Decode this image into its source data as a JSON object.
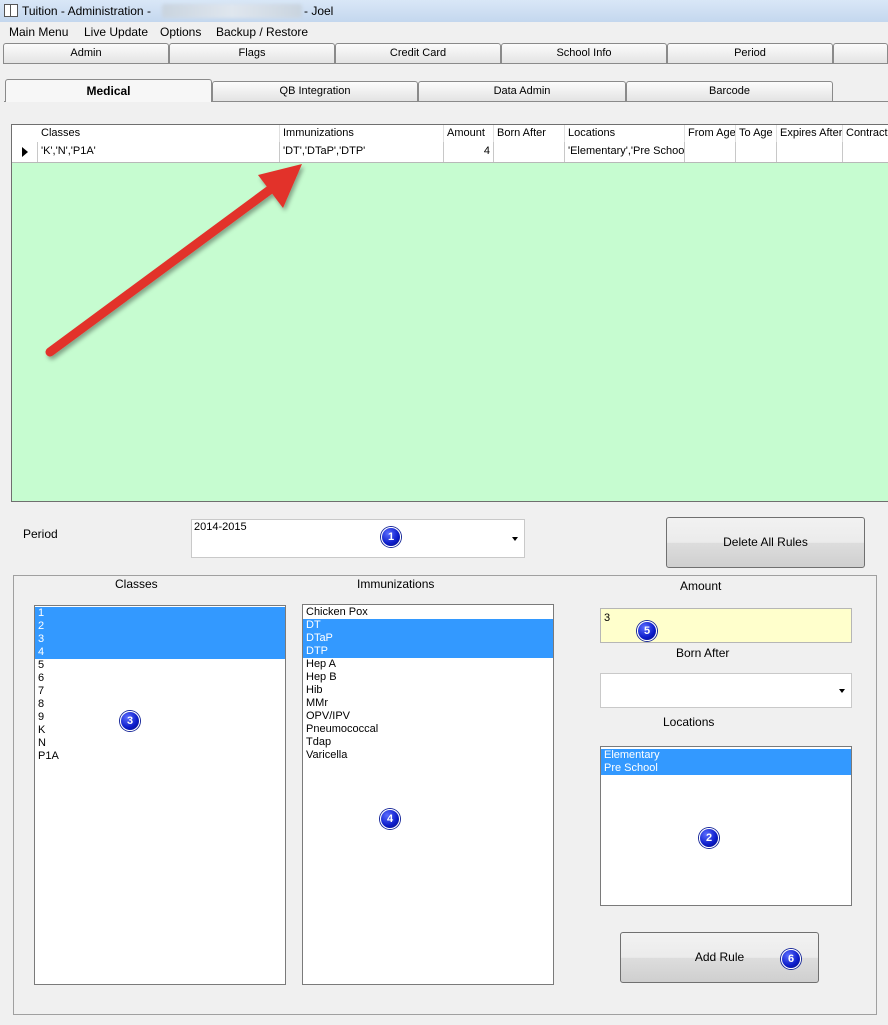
{
  "window": {
    "title_prefix": "Tuition - Administration -",
    "title_suffix": "- Joel"
  },
  "menu": [
    "Main Menu",
    "Live Update",
    "Options",
    "Backup / Restore"
  ],
  "tabs_row1": [
    "Admin",
    "Flags",
    "Credit Card",
    "School Info",
    "Period"
  ],
  "tabs_row2": [
    "Medical",
    "QB Integration",
    "Data Admin",
    "Barcode"
  ],
  "active_tab": "Medical",
  "grid": {
    "columns": [
      "Classes",
      "Immunizations",
      "Amount",
      "Born After",
      "Locations",
      "From Age",
      "To Age",
      "Expires After",
      "Contract"
    ],
    "rows": [
      {
        "classes": "'K','N','P1A'",
        "immunizations": "'DT','DTaP','DTP'",
        "amount": "4",
        "born_after": "",
        "locations": "'Elementary','Pre School'",
        "from_age": "",
        "to_age": "",
        "expires_after": "",
        "contract": ""
      }
    ],
    "background_color": "#c6fcd0"
  },
  "form": {
    "period_label": "Period",
    "period_value": "2014-2015",
    "delete_all_label": "Delete All Rules",
    "classes_label": "Classes",
    "immunizations_label": "Immunizations",
    "amount_label": "Amount",
    "amount_value": "3",
    "born_after_label": "Born After",
    "born_after_value": "",
    "locations_label": "Locations",
    "add_rule_label": "Add Rule",
    "classes": [
      {
        "text": "1",
        "selected": true
      },
      {
        "text": "2",
        "selected": true
      },
      {
        "text": "3",
        "selected": true
      },
      {
        "text": "4",
        "selected": true
      },
      {
        "text": "5",
        "selected": false
      },
      {
        "text": "6",
        "selected": false
      },
      {
        "text": "7",
        "selected": false
      },
      {
        "text": "8",
        "selected": false
      },
      {
        "text": "9",
        "selected": false
      },
      {
        "text": "K",
        "selected": false
      },
      {
        "text": "N",
        "selected": false
      },
      {
        "text": "P1A",
        "selected": false
      }
    ],
    "immunizations": [
      {
        "text": "Chicken Pox",
        "selected": false
      },
      {
        "text": "DT",
        "selected": true
      },
      {
        "text": "DTaP",
        "selected": true
      },
      {
        "text": "DTP",
        "selected": true
      },
      {
        "text": "Hep A",
        "selected": false
      },
      {
        "text": "Hep B",
        "selected": false
      },
      {
        "text": "Hib",
        "selected": false
      },
      {
        "text": "MMr",
        "selected": false
      },
      {
        "text": "OPV/IPV",
        "selected": false
      },
      {
        "text": "Pneumococcal",
        "selected": false
      },
      {
        "text": "Tdap",
        "selected": false
      },
      {
        "text": "Varicella",
        "selected": false
      }
    ],
    "locations": [
      {
        "text": "Elementary",
        "selected": true
      },
      {
        "text": "Pre School",
        "selected": true
      }
    ]
  },
  "badges": [
    "1",
    "2",
    "3",
    "4",
    "5",
    "6"
  ],
  "annotation_arrow_color": "#e2302a",
  "selection_color": "#3399ff",
  "amount_bg": "#ffffcc"
}
